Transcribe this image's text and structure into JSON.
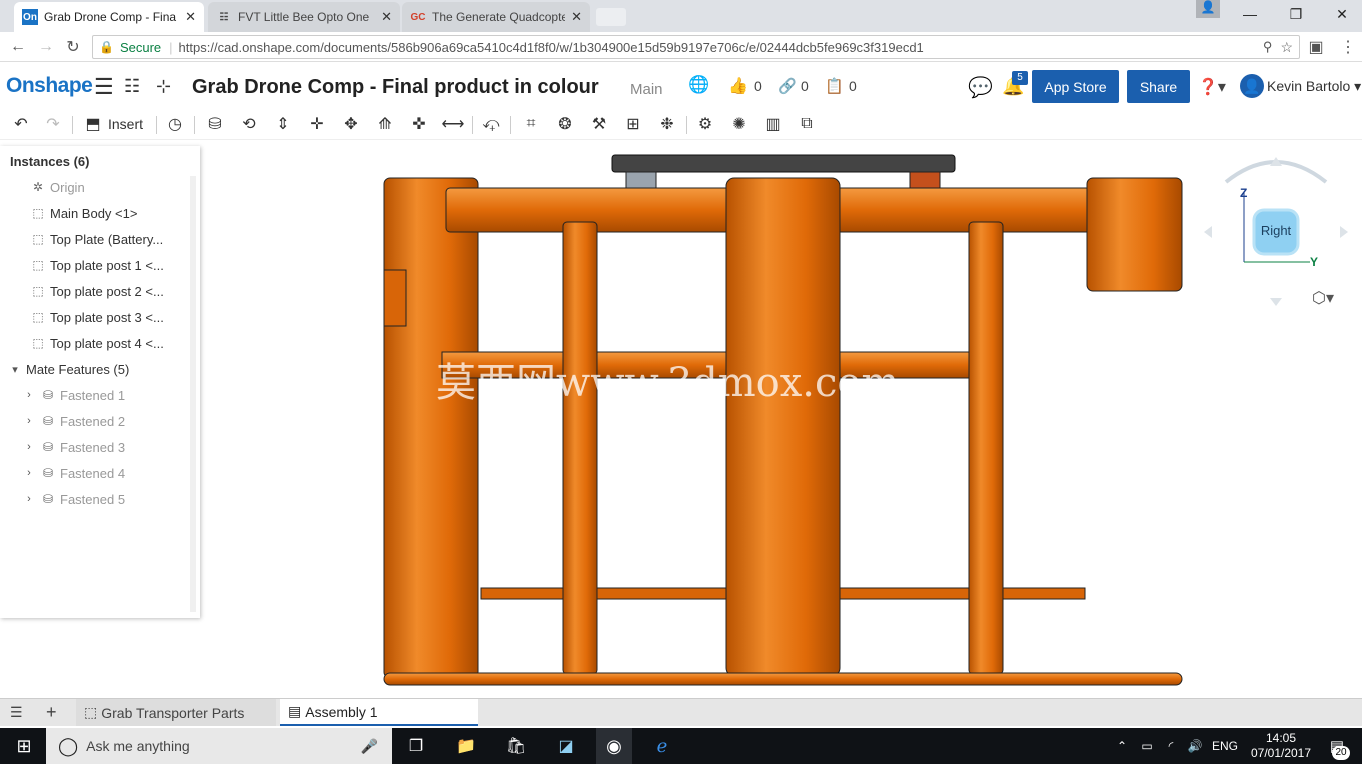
{
  "browser": {
    "tabs": [
      {
        "icon": "On",
        "title": "Grab Drone Comp - Fina"
      },
      {
        "icon": "☷",
        "title": "FVT Little Bee Opto One"
      },
      {
        "icon": "GC",
        "title": "The Generate Quadcopte"
      }
    ],
    "secure_label": "Secure",
    "url": "https://cad.onshape.com/documents/586b906a69ca5410c4d1f8f0/w/1b304900e15d59b9197e706c/e/02444dcb5fe969c3f319ecd1"
  },
  "header": {
    "logo": "Onshape",
    "document_title": "Grab Drone Comp - Final product in colour",
    "branch": "Main",
    "likes": "0",
    "links": "0",
    "copies": "0",
    "notifications": "5",
    "app_store": "App Store",
    "share": "Share",
    "user": "Kevin Bartolo"
  },
  "toolbar": {
    "insert": "Insert"
  },
  "panel": {
    "instances_header": "Instances (6)",
    "instances": [
      "Origin",
      "Main Body <1>",
      "Top Plate (Battery...",
      "Top plate post 1 <...",
      "Top plate post 2 <...",
      "Top plate post 3 <...",
      "Top plate post 4 <..."
    ],
    "mates_header": "Mate Features (5)",
    "mates": [
      "Fastened 1",
      "Fastened 2",
      "Fastened 3",
      "Fastened 4",
      "Fastened 5"
    ]
  },
  "viewcube": {
    "face": "Right",
    "axis_z": "Z",
    "axis_y": "Y"
  },
  "watermark": "莫西网www.3dmox.com",
  "bottom_tabs": [
    "Grab Transporter Parts",
    "Assembly 1"
  ],
  "taskbar": {
    "search_placeholder": "Ask me anything",
    "lang": "ENG",
    "time": "14:05",
    "date": "07/01/2017",
    "notif_count": "20"
  },
  "colors": {
    "accent": "#1b5fae",
    "part_orange": "#e8720c",
    "part_dark": "#b85200"
  }
}
